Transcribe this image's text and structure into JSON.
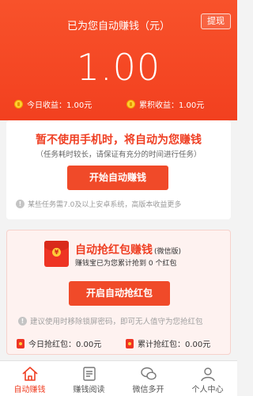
{
  "header": {
    "title": "已为您自动赚钱（元）",
    "withdraw_label": "提现",
    "total_amount": "1.00",
    "today_income": "今日收益：1.00元",
    "total_income": "累积收益：1.00元"
  },
  "auto_earn_card": {
    "title": "暂不使用手机时，将自动为您赚钱",
    "subtitle": "（任务耗时较长，请保证有充分的时间进行任务）",
    "start_button": "开始自动赚钱",
    "note": "某些任务需7.0及以上安卓系统，高版本收益更多"
  },
  "red_packet_card": {
    "title": "自动抢红包赚钱",
    "title_suffix": "(微信版)",
    "subtitle": "赚钱宝已为您累计抢到 0 个红包",
    "envelope_symbol": "¥",
    "start_button": "开启自动抢红包",
    "note": "建议使用时移除锁屏密码，即可无人值守为您抢红包",
    "today_packets": "今日抢红包：0.00元",
    "total_packets": "累计抢红包：0.00元"
  },
  "bottom_nav": {
    "items": [
      {
        "label": "自动赚钱",
        "icon": "home-icon",
        "active": true
      },
      {
        "label": "赚钱阅读",
        "icon": "reading-icon",
        "active": false
      },
      {
        "label": "微信多开",
        "icon": "chat-icon",
        "active": false
      },
      {
        "label": "个人中心",
        "icon": "user-icon",
        "active": false
      }
    ]
  },
  "colors": {
    "brand_red": "#f04a29",
    "header_gradient_top": "#f8522b",
    "accent_text": "#ef3f23"
  }
}
